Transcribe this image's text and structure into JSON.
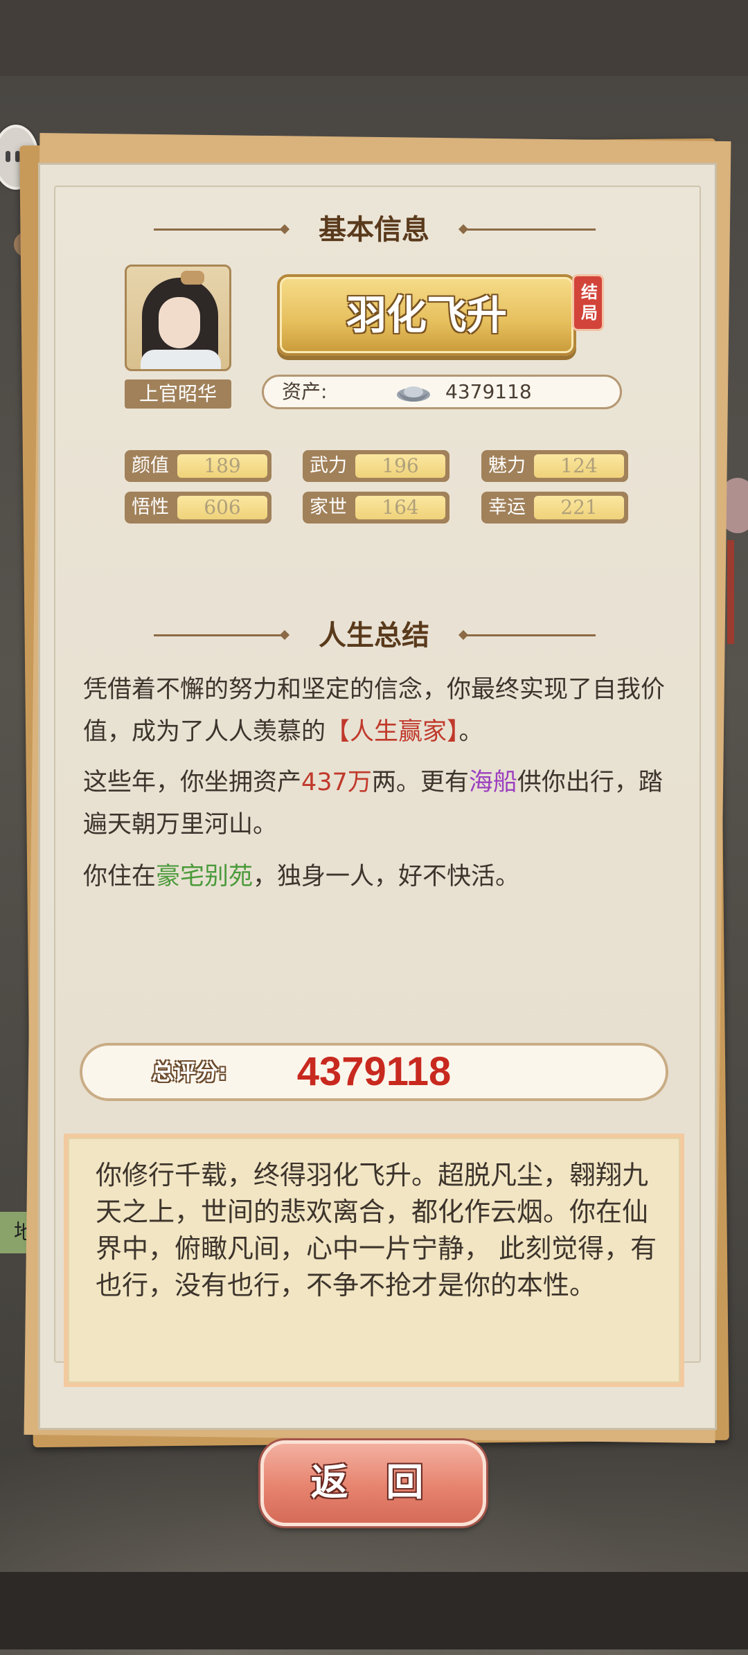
{
  "basic_info": {
    "title": "基本信息",
    "name": "上官昭华",
    "rank": "羽化飞升",
    "end_badge": "结局",
    "asset_label": "资产:",
    "asset_value": "4379118",
    "stats": [
      {
        "label": "颜值",
        "value": "189"
      },
      {
        "label": "武力",
        "value": "196"
      },
      {
        "label": "魅力",
        "value": "124"
      },
      {
        "label": "悟性",
        "value": "606"
      },
      {
        "label": "家世",
        "value": "164"
      },
      {
        "label": "幸运",
        "value": "221"
      }
    ]
  },
  "summary": {
    "title": "人生总结",
    "p1_a": "凭借着不懈的努力和坚定的信念，你最终实现了自我价值，成为了人人羡慕的",
    "p1_highlight": "【人生赢家】",
    "p1_b": "。",
    "p2_a": "这些年，你坐拥资产",
    "p2_assets": "437万",
    "p2_b": "两。更有",
    "p2_vehicle": "海船",
    "p2_c": "供你出行，踏遍天朝万里河山。",
    "p3_a": "你住在",
    "p3_home": "豪宅别苑",
    "p3_b": "，独身一人，好不快活。"
  },
  "score": {
    "label": "总评分:",
    "value": "4379118"
  },
  "epilogue": "你修行千载，终得羽化飞升。超脱凡尘，翱翔九天之上，世间的悲欢离合，都化作云烟。你在仙界中，俯瞰凡间，心中一片宁静， 此刻觉得，有也行，没有也行，不争不抢才是你的本性。",
  "back_button": "返 回",
  "background": {
    "side_tag": "地"
  },
  "colors": {
    "accent_gold": "#e6bf5d",
    "score_red": "#c8291f",
    "highlight_red": "#c0392b",
    "highlight_purple": "#9b3fbf",
    "highlight_green": "#4a9a3a",
    "back_button": "#e6836e"
  },
  "icons": {
    "asset": "silver-ingot-icon",
    "chat": "chat-bubble-icon"
  }
}
